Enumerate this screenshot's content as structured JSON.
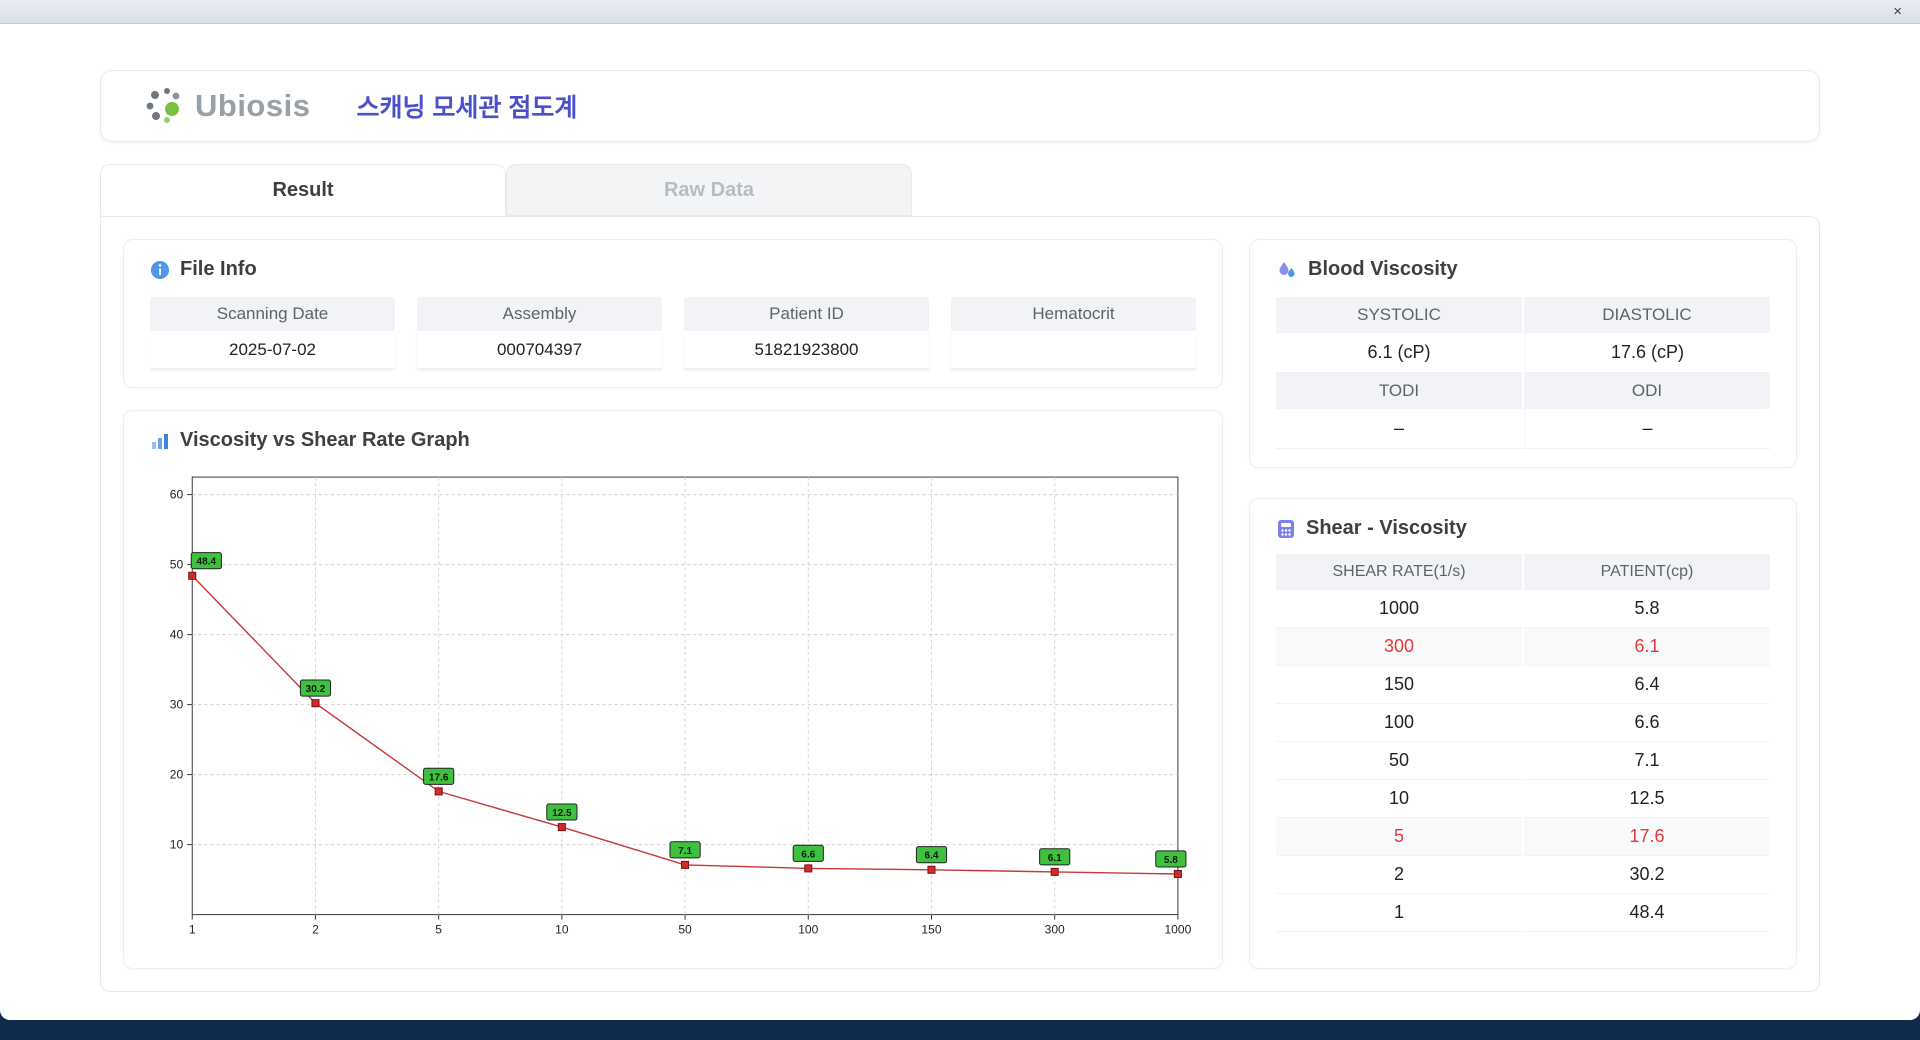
{
  "window": {
    "close_label": "×"
  },
  "header": {
    "logo_text": "Ubiosis",
    "app_title": "스캐닝 모세관 점도계"
  },
  "tabs": [
    {
      "label": "Result",
      "active": true
    },
    {
      "label": "Raw Data",
      "active": false
    }
  ],
  "file_info": {
    "title": "File Info",
    "fields": [
      {
        "label": "Scanning Date",
        "value": "2025-07-02"
      },
      {
        "label": "Assembly",
        "value": "000704397"
      },
      {
        "label": "Patient ID",
        "value": "51821923800"
      },
      {
        "label": "Hematocrit",
        "value": ""
      }
    ]
  },
  "graph": {
    "title": "Viscosity vs Shear Rate Graph"
  },
  "chart_data": {
    "type": "line",
    "title": "Viscosity vs Shear Rate Graph",
    "categories": [
      "1",
      "2",
      "5",
      "10",
      "50",
      "100",
      "150",
      "300",
      "1000"
    ],
    "values": [
      48.4,
      30.2,
      17.6,
      12.5,
      7.1,
      6.6,
      6.4,
      6.1,
      5.8
    ],
    "xlabel": "",
    "ylabel": "",
    "ylim": [
      0,
      62.5
    ],
    "yticks": [
      10,
      20,
      30,
      40,
      50,
      60
    ],
    "grid": true,
    "legend": false,
    "line_color": "#c43a3a",
    "marker_color": "#d32b2b",
    "marker_border": "#7a1212",
    "label_bg": "#3ec23e",
    "label_border": "#222222",
    "label_text": "#0d1a0d"
  },
  "blood_viscosity": {
    "title": "Blood Viscosity",
    "rows": [
      {
        "labels": [
          "SYSTOLIC",
          "DIASTOLIC"
        ],
        "values": [
          "6.1 (cP)",
          "17.6 (cP)"
        ]
      },
      {
        "labels": [
          "TODI",
          "ODI"
        ],
        "values": [
          "–",
          "–"
        ]
      }
    ]
  },
  "shear_viscosity": {
    "title": "Shear - Viscosity",
    "columns": [
      "SHEAR RATE(1/s)",
      "PATIENT(cp)"
    ],
    "rows": [
      {
        "shear": "1000",
        "patient": "5.8",
        "highlight": false
      },
      {
        "shear": "300",
        "patient": "6.1",
        "highlight": true
      },
      {
        "shear": "150",
        "patient": "6.4",
        "highlight": false
      },
      {
        "shear": "100",
        "patient": "6.6",
        "highlight": false
      },
      {
        "shear": "50",
        "patient": "7.1",
        "highlight": false
      },
      {
        "shear": "10",
        "patient": "12.5",
        "highlight": false
      },
      {
        "shear": "5",
        "patient": "17.6",
        "highlight": true
      },
      {
        "shear": "2",
        "patient": "30.2",
        "highlight": false
      },
      {
        "shear": "1",
        "patient": "48.4",
        "highlight": false
      }
    ]
  },
  "colors": {
    "accent_blue": "#4a51c8",
    "alert_red": "#e03a3a",
    "label_green": "#3ec23e",
    "header_gray": "#f1f3f6"
  }
}
